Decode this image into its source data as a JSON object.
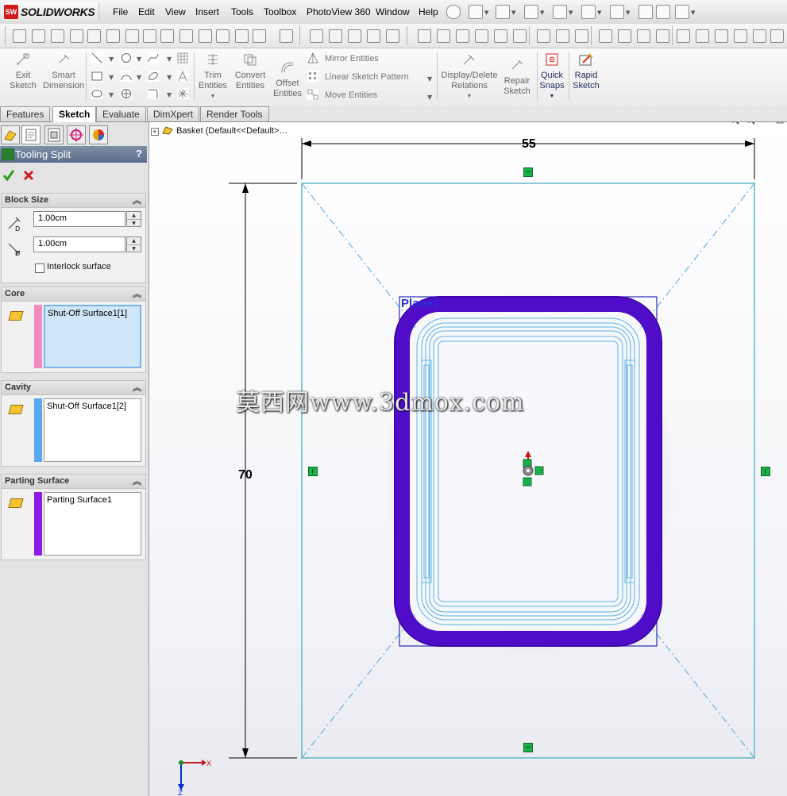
{
  "app": {
    "logo_text": "SOLIDWORKS",
    "logo_badge": "SW"
  },
  "menu": {
    "items": [
      "File",
      "Edit",
      "View",
      "Insert",
      "Tools",
      "Toolbox",
      "PhotoView 360",
      "Window",
      "Help"
    ]
  },
  "command_manager": {
    "exit_sketch": [
      "Exit",
      "Sketch"
    ],
    "smart_dimension": [
      "Smart",
      "Dimension"
    ],
    "trim_entities": [
      "Trim",
      "Entities"
    ],
    "convert_entities": [
      "Convert",
      "Entities"
    ],
    "offset_entities": [
      "Offset",
      "Entities"
    ],
    "mirror_entities": "Mirror Entities",
    "linear_sketch_pattern": "Linear Sketch Pattern",
    "move_entities": "Move Entities",
    "display_delete_relations": [
      "Display/Delete",
      "Relations"
    ],
    "repair_sketch": [
      "Repair",
      "Sketch"
    ],
    "quick_snaps": [
      "Quick",
      "Snaps"
    ],
    "rapid_sketch": [
      "Rapid",
      "Sketch"
    ]
  },
  "tabs": [
    {
      "label": "Features"
    },
    {
      "label": "Sketch",
      "active": true
    },
    {
      "label": "Evaluate"
    },
    {
      "label": "DimXpert"
    },
    {
      "label": "Render Tools"
    }
  ],
  "property_manager": {
    "title": "Tooling Split",
    "help": "?",
    "block_size": {
      "header": "Block Size",
      "depth1": "1.00cm",
      "depth2": "1.00cm",
      "interlock_label": "Interlock surface"
    },
    "core": {
      "header": "Core",
      "item": "Shut-Off Surface1[1]",
      "color": "#f08cbf"
    },
    "cavity": {
      "header": "Cavity",
      "item": "Shut-Off Surface1[2]",
      "color": "#59a8ee"
    },
    "parting_surface": {
      "header": "Parting Surface",
      "item": "Parting Surface1",
      "color": "#8f1ae6"
    }
  },
  "graphics": {
    "tree_root": "Basket  (Default<<Default>…",
    "dim_width": "55",
    "dim_height": "70",
    "plane_label": "Plane2",
    "watermark": "莫西网www.3dmox.com",
    "triad_x": "X",
    "triad_z": "Z",
    "rim_color": "#4f0cc9",
    "sketch_color": "#59b1e6"
  }
}
